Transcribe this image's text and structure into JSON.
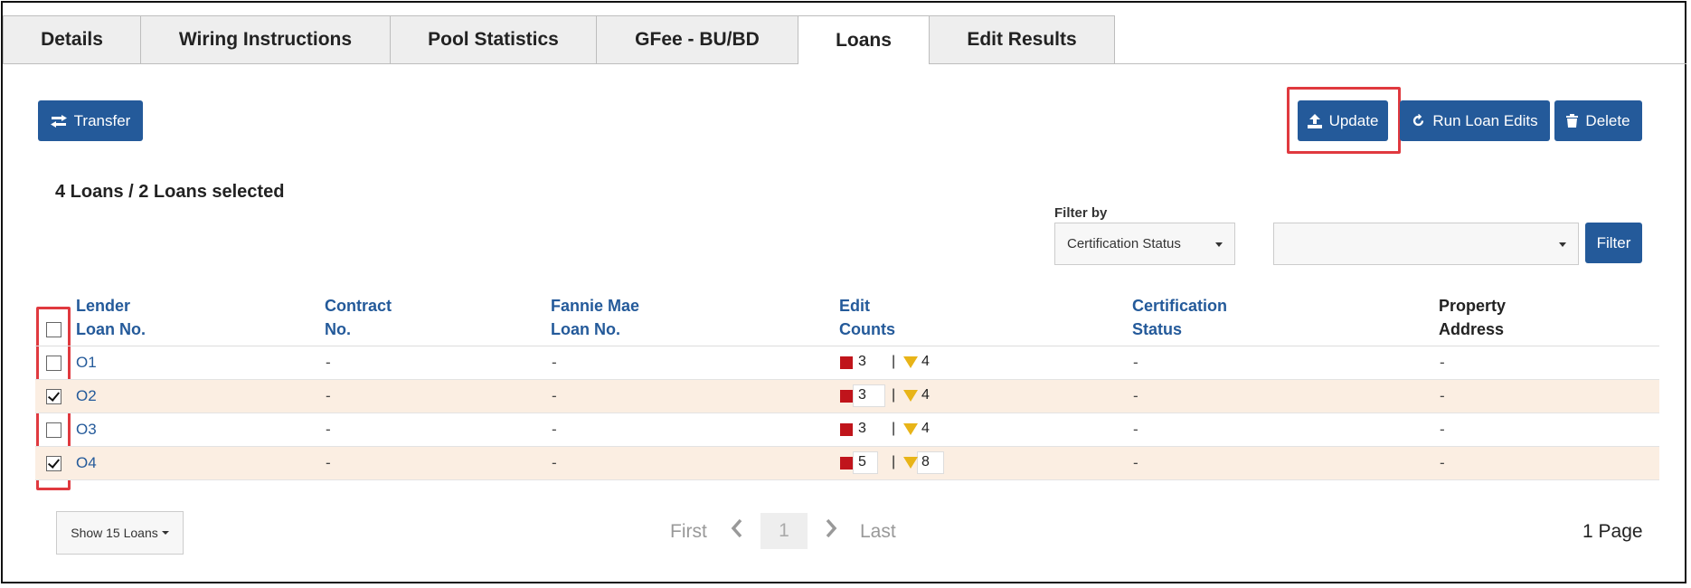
{
  "tabs": [
    "Details",
    "Wiring Instructions",
    "Pool Statistics",
    "GFee - BU/BD",
    "Loans",
    "Edit Results"
  ],
  "active_tab": "Loans",
  "toolbar": {
    "transfer_label": "Transfer",
    "update_label": "Update",
    "run_edits_label": "Run Loan Edits",
    "delete_label": "Delete"
  },
  "summary": "4 Loans / 2 Loans selected",
  "filter": {
    "label": "Filter by",
    "field_value": "Certification Status",
    "value_value": "",
    "button_label": "Filter"
  },
  "table": {
    "headers": [
      [
        "Lender",
        "Loan No."
      ],
      [
        "Contract",
        "No."
      ],
      [
        "Fannie Mae",
        "Loan No."
      ],
      [
        "Edit",
        "Counts"
      ],
      [
        "Certification",
        "Status"
      ],
      [
        "Property",
        "Address"
      ]
    ],
    "rows": [
      {
        "loan": "O1",
        "contract": "-",
        "fm_loan": "-",
        "fatal": "3",
        "warn": "4",
        "cert": "-",
        "address": "-",
        "checked": false
      },
      {
        "loan": "O2",
        "contract": "-",
        "fm_loan": "-",
        "fatal": "3",
        "warn": "4",
        "cert": "-",
        "address": "-",
        "checked": true
      },
      {
        "loan": "O3",
        "contract": "-",
        "fm_loan": "-",
        "fatal": "3",
        "warn": "4",
        "cert": "-",
        "address": "-",
        "checked": false
      },
      {
        "loan": "O4",
        "contract": "-",
        "fm_loan": "-",
        "fatal": "5",
        "warn": "8",
        "cert": "-",
        "address": "-",
        "checked": true
      }
    ],
    "edit_separator": "|"
  },
  "footer": {
    "show_label": "Show 15 Loans",
    "first_label": "First",
    "current_page": "1",
    "last_label": "Last",
    "page_count": "1 Page"
  },
  "colors": {
    "primary": "#245a9a",
    "highlight": "#e0393f",
    "fatal": "#c0141b",
    "warning": "#e8b418",
    "selected_row": "#fbeee2"
  },
  "icons": {
    "transfer": "transfer-arrows-icon",
    "update": "upload-icon",
    "run_edits": "refresh-icon",
    "delete": "trash-icon",
    "fatal": "red-square-icon",
    "warning": "yellow-triangle-icon"
  }
}
